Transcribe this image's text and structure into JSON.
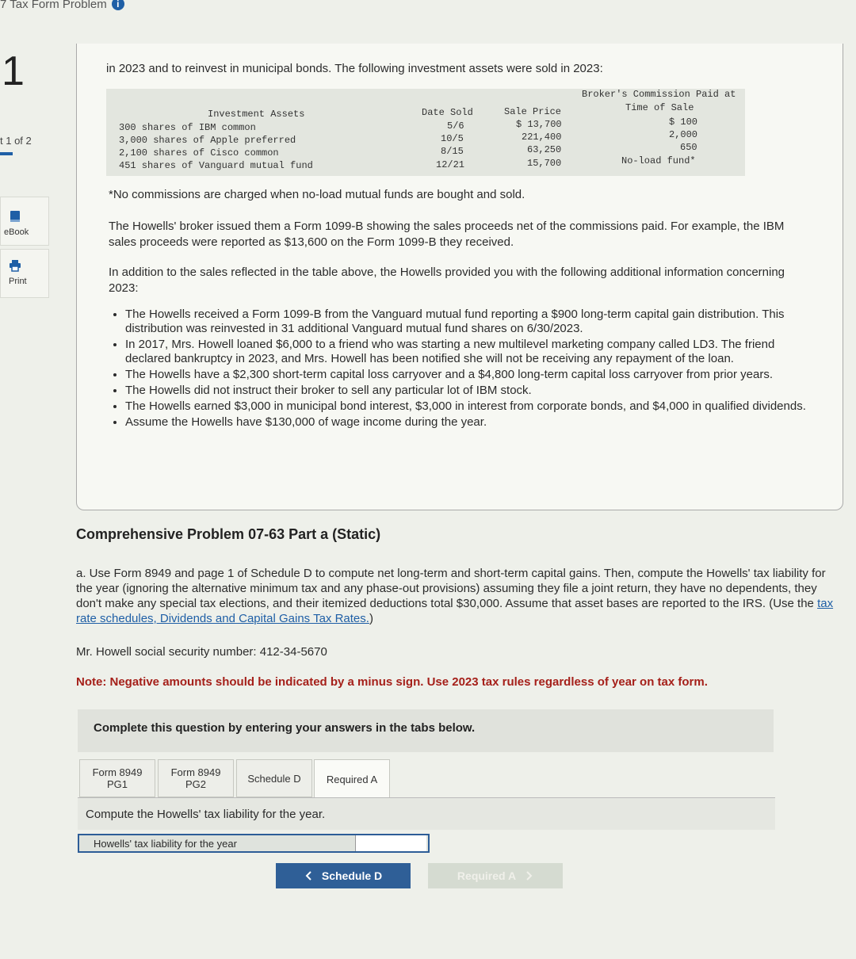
{
  "header": {
    "title": "7 Tax Form Problem",
    "info_icon": "i"
  },
  "rail": {
    "question_number": "1",
    "part_of": "t 1 of 2",
    "ebook_label": "eBook",
    "print_label": "Print"
  },
  "problem": {
    "intro": "in 2023 and to reinvest in municipal bonds. The following investment assets were sold in 2023:",
    "table": {
      "headers": {
        "asset": "Investment Assets",
        "date": "Date Sold",
        "price": "Sale Price",
        "commission_line1": "Broker's Commission Paid at",
        "commission_line2": "Time of Sale"
      },
      "rows": [
        {
          "asset": "300 shares of IBM common",
          "date": "5/6",
          "price": "$ 13,700",
          "commission": "$ 100"
        },
        {
          "asset": "3,000 shares of Apple preferred",
          "date": "10/5",
          "price": "221,400",
          "commission": "2,000"
        },
        {
          "asset": "2,100 shares of Cisco common",
          "date": "8/15",
          "price": "63,250",
          "commission": "650"
        },
        {
          "asset": "451 shares of Vanguard mutual fund",
          "date": "12/21",
          "price": "15,700",
          "commission": "No-load fund*"
        }
      ]
    },
    "footnote": "*No commissions are charged when no-load mutual funds are bought and sold.",
    "para1": "The Howells' broker issued them a Form 1099-B showing the sales proceeds net of the commissions paid. For example, the IBM sales proceeds were reported as $13,600 on the Form 1099-B they received.",
    "para2": "In addition to the sales reflected in the table above, the Howells provided you with the following additional information concerning 2023:",
    "bullets": [
      "The Howells received a Form 1099-B from the Vanguard mutual fund reporting a $900 long-term capital gain distribution. This distribution was reinvested in 31 additional Vanguard mutual fund shares on 6/30/2023.",
      "In 2017, Mrs. Howell loaned $6,000 to a friend who was starting a new multilevel marketing company called LD3. The friend declared bankruptcy in 2023, and Mrs. Howell has been notified she will not be receiving any repayment of the loan.",
      "The Howells have a $2,300 short-term capital loss carryover and a $4,800 long-term capital loss carryover from prior years.",
      "The Howells did not instruct their broker to sell any particular lot of IBM stock.",
      "The Howells earned $3,000 in municipal bond interest, $3,000 in interest from corporate bonds, and $4,000 in qualified dividends.",
      "Assume the Howells have $130,000 of wage income during the year."
    ]
  },
  "section": {
    "title": "Comprehensive Problem 07-63 Part a (Static)",
    "part_a_text": "a. Use Form 8949 and page 1 of Schedule D to compute net long-term and short-term capital gains. Then, compute the Howells' tax liability for the year (ignoring the alternative minimum tax and any phase-out provisions) assuming they file a joint return, they have no dependents, they don't make any special tax elections, and their itemized deductions total $30,000. Assume that asset bases are reported to the IRS. (Use the ",
    "link_text": "tax rate schedules, Dividends and Capital Gains Tax Rates.",
    "part_a_tail": ")",
    "ssn": "Mr. Howell social security number: 412-34-5670",
    "note": "Note: Negative amounts should be indicated by a minus sign. Use 2023 tax rules regardless of year on tax form."
  },
  "tabs": {
    "instruction": "Complete this question by entering your answers in the tabs below.",
    "items": [
      {
        "line1": "Form 8949",
        "line2": "PG1"
      },
      {
        "line1": "Form 8949",
        "line2": "PG2"
      },
      {
        "line1": "Schedule D",
        "line2": ""
      },
      {
        "line1": "Required A",
        "line2": ""
      }
    ],
    "compute_label": "Compute the Howells' tax liability for the year.",
    "liability_label": "Howells' tax liability for the year",
    "liability_value": "",
    "prev_button": "Schedule D",
    "next_button": "Required A"
  }
}
